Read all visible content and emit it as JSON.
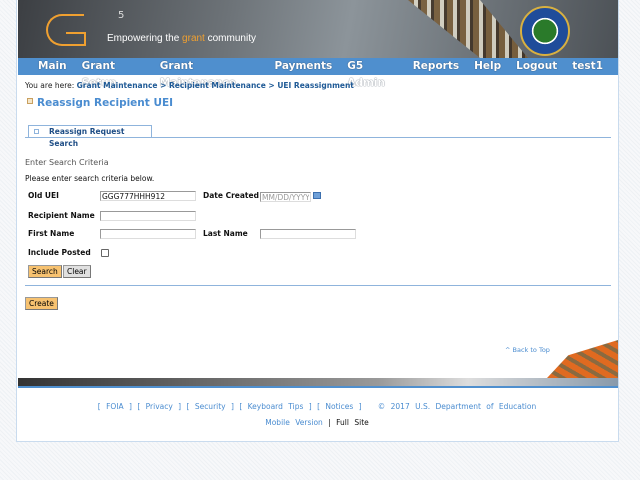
{
  "header": {
    "logo": "G5",
    "tagline_pre": "Empowering the ",
    "tagline_accent": "grant",
    "tagline_post": " community",
    "seal": "Department of Education seal"
  },
  "nav": [
    "Main",
    "Grant Setup",
    "Grant Maintenance",
    "Payments",
    "G5 Admin",
    "Reports",
    "Help",
    "Logout",
    "test1"
  ],
  "breadcrumb": {
    "prefix": "You are here:",
    "path": "Grant Maintenance > Recipient Maintenance > UEI Reassignment"
  },
  "page_title": "Reassign Recipient UEI",
  "tab": "Reassign Request Search",
  "form": {
    "heading": "Enter Search Criteria",
    "instructions": "Please enter search criteria below.",
    "old_uei_label": "Old UEI",
    "old_uei_value": "GGG777HHH912",
    "date_created_label": "Date Created",
    "date_placeholder": "MM/DD/YYYY",
    "recipient_name_label": "Recipient Name",
    "first_name_label": "First Name",
    "last_name_label": "Last Name",
    "include_posted_label": "Include Posted",
    "include_posted": false,
    "search": "Search",
    "clear": "Clear",
    "create": "Create"
  },
  "back_to_top": "^ Back to Top",
  "footer": {
    "links": [
      "FOIA",
      "Privacy",
      "Security",
      "Keyboard Tips",
      "Notices"
    ],
    "copyright": "© 2017 U.S. Department of Education",
    "mobile": "Mobile Version",
    "sep": "|",
    "full": "Full Site"
  },
  "colors": {
    "nav": "#4f8fce",
    "accent": "#f0a030",
    "button": "#f7c270"
  }
}
